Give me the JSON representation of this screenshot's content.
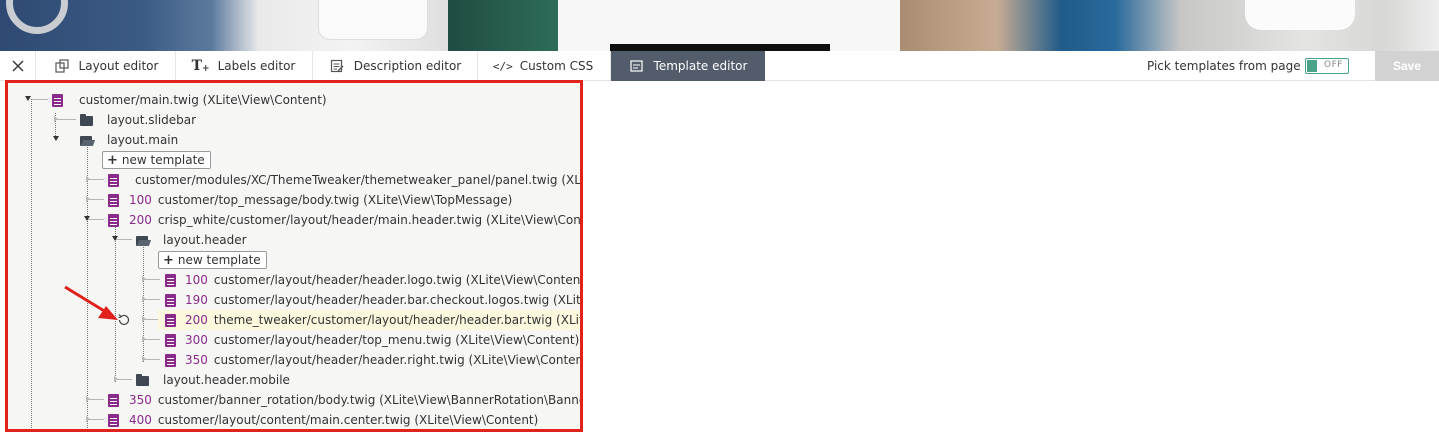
{
  "toolbar": {
    "tabs": [
      {
        "label": "Layout editor",
        "icon": "layout-icon"
      },
      {
        "label": "Labels editor",
        "icon": "text-icon"
      },
      {
        "label": "Description editor",
        "icon": "description-icon"
      },
      {
        "label": "Custom CSS",
        "icon": "code-icon"
      },
      {
        "label": "Template editor",
        "icon": "template-icon"
      }
    ],
    "active_tab": "Template editor",
    "pick_label": "Pick templates from page",
    "toggle_label": "OFF",
    "save_label": "Save",
    "close_icon": "close-icon"
  },
  "colors": {
    "active_tab_bg": "#525c6a",
    "toggle_accent": "#48a389",
    "priority": "#8a2a8a",
    "highlight_border": "#e1211c",
    "highlight_row": "#fbf8de"
  },
  "tree": {
    "rows": [
      {
        "type": "file",
        "priority": "",
        "label": "customer/main.twig (XLite\\View\\Content)"
      },
      {
        "type": "folder",
        "label": "layout.slidebar"
      },
      {
        "type": "folder-open",
        "label": "layout.main"
      },
      {
        "type": "new",
        "label": "new template"
      },
      {
        "type": "file",
        "priority": "",
        "label": "customer/modules/XC/ThemeTweaker/themetweaker_panel/panel.twig (XLite\\M"
      },
      {
        "type": "file",
        "priority": "100",
        "label": "customer/top_message/body.twig (XLite\\View\\TopMessage)"
      },
      {
        "type": "file",
        "priority": "200",
        "label": "crisp_white/customer/layout/header/main.header.twig (XLite\\View\\Content)"
      },
      {
        "type": "folder-open",
        "label": "layout.header"
      },
      {
        "type": "new",
        "label": "new template"
      },
      {
        "type": "file",
        "priority": "100",
        "label": "customer/layout/header/header.logo.twig (XLite\\View\\Content)"
      },
      {
        "type": "file",
        "priority": "190",
        "label": "customer/layout/header/header.bar.checkout.logos.twig (XLite\\Vi"
      },
      {
        "type": "file",
        "priority": "200",
        "label": "theme_tweaker/customer/layout/header/header.bar.twig (XLite\\V"
      },
      {
        "type": "file",
        "priority": "300",
        "label": "customer/layout/header/top_menu.twig (XLite\\View\\Content)"
      },
      {
        "type": "file",
        "priority": "350",
        "label": "customer/layout/header/header.right.twig (XLite\\View\\Content)"
      },
      {
        "type": "folder",
        "label": "layout.header.mobile"
      },
      {
        "type": "file",
        "priority": "350",
        "label": "customer/banner_rotation/body.twig (XLite\\View\\BannerRotation\\BannerRo"
      },
      {
        "type": "file",
        "priority": "400",
        "label": "customer/layout/content/main.center.twig (XLite\\View\\Content)"
      }
    ]
  }
}
